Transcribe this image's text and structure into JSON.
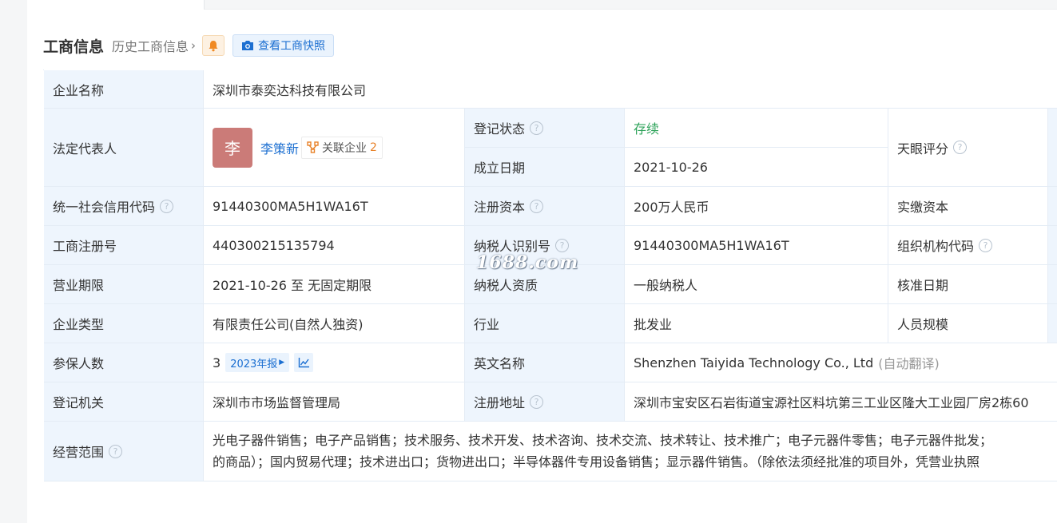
{
  "section": {
    "title": "工商信息",
    "history_link": "历史工商信息",
    "bell_icon": "bell-icon",
    "snapshot_button": "查看工商快照",
    "snapshot_icon": "camera-icon"
  },
  "watermark": "1688.com",
  "colors": {
    "label_bg": "#eef5fd",
    "link": "#1c6fd1",
    "status_green": "#2ea35a",
    "avatar": "#cb7b78"
  },
  "rows": {
    "company_name": {
      "label": "企业名称",
      "value": "深圳市泰奕达科技有限公司"
    },
    "legal_rep": {
      "label": "法定代表人",
      "avatar_char": "李",
      "name": "李策新",
      "related_label": "关联企业",
      "related_count": "2"
    },
    "reg_status": {
      "label": "登记状态",
      "value": "存续"
    },
    "found_date": {
      "label": "成立日期",
      "value": "2021-10-26"
    },
    "tianyan_score": {
      "label": "天眼评分"
    },
    "credit_code": {
      "label": "统一社会信用代码",
      "value": "91440300MA5H1WA16T"
    },
    "reg_capital": {
      "label": "注册资本",
      "value": "200万人民币"
    },
    "paid_capital": {
      "label": "实缴资本"
    },
    "biz_reg_no": {
      "label": "工商注册号",
      "value": "440300215135794"
    },
    "taxpayer_id": {
      "label": "纳税人识别号",
      "value": "91440300MA5H1WA16T"
    },
    "org_code": {
      "label": "组织机构代码"
    },
    "biz_term": {
      "label": "营业期限",
      "value": "2021-10-26 至 无固定期限"
    },
    "taxpayer_type": {
      "label": "纳税人资质",
      "value": "一般纳税人"
    },
    "approval_date": {
      "label": "核准日期"
    },
    "company_type": {
      "label": "企业类型",
      "value": "有限责任公司(自然人独资)"
    },
    "industry": {
      "label": "行业",
      "value": "批发业"
    },
    "staff_size": {
      "label": "人员规模"
    },
    "insured": {
      "label": "参保人数",
      "value": "3",
      "year_tag": "2023年报"
    },
    "english_name": {
      "label": "英文名称",
      "value": "Shenzhen Taiyida Technology Co., Ltd",
      "note": "(自动翻译)"
    },
    "reg_authority": {
      "label": "登记机关",
      "value": "深圳市市场监督管理局"
    },
    "reg_address": {
      "label": "注册地址",
      "value": "深圳市宝安区石岩街道宝源社区料坑第三工业区隆大工业园厂房2栋60"
    },
    "scope": {
      "label": "经营范围",
      "line1": "光电子器件销售；电子产品销售；技术服务、技术开发、技术咨询、技术交流、技术转让、技术推广；电子元器件零售；电子元器件批发；",
      "line2": "的商品）；国内贸易代理；技术进出口；货物进出口；半导体器件专用设备销售；显示器件销售。（除依法须经批准的项目外，凭营业执照"
    }
  }
}
